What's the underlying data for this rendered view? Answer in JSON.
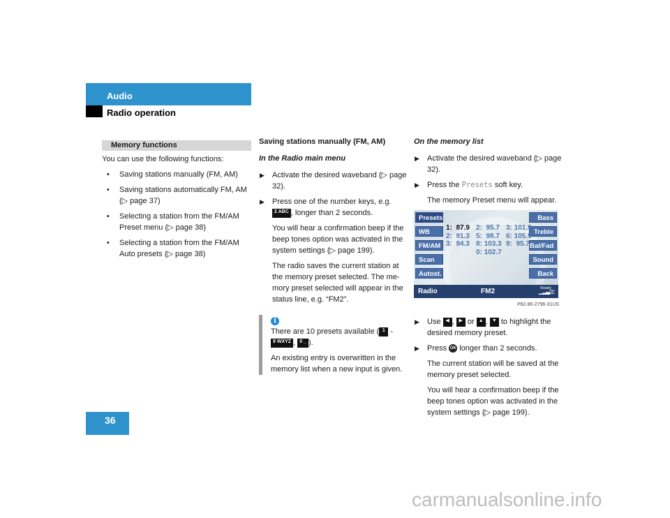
{
  "header": {
    "section": "Audio",
    "subsection": "Radio operation"
  },
  "page_number": "36",
  "left_column": {
    "section_title": "Memory functions",
    "intro": "You can use the following functions:",
    "bullet_glyph": "•",
    "bullets": [
      "Saving stations manually (FM, AM)",
      "Saving stations automatically FM, AM (▷ page 37)",
      "Selecting a station from the FM/AM Preset menu (▷ page 38)",
      "Selecting a station from the FM/AM Auto presets (▷ page 38)"
    ]
  },
  "middle_column": {
    "heading": "Saving stations manually (FM, AM)",
    "subheading": "In the Radio main menu",
    "step_glyph": "▶",
    "step1": "Activate the desired waveband (▷ page 32).",
    "step2_before": "Press one of the number keys, e.g.",
    "step2_key": "2 ABC",
    "step2_after": ", longer than 2 seconds.",
    "para1": "You will hear a confirmation beep if the beep tones option was activated in the system settings (▷ page 199).",
    "para2": "The radio saves the current station at the memory preset selected. The me-mory preset selected will appear in the status line, e.g. “FM2”.",
    "note": {
      "icon": "i",
      "line1_before": "There are 10 presets available (",
      "key_1": "1",
      "dash": " -",
      "key_9": "9 WXYZ",
      "comma": ",",
      "key_0": "0 _",
      "line1_after": ").",
      "line2": "An existing entry is overwritten in the memory list when a new input is given."
    }
  },
  "right_column": {
    "subheading": "On the memory list",
    "step1": "Activate the desired waveband (▷ page 32).",
    "step2_before": "Press the",
    "step2_softkey": "Presets",
    "step2_after": "soft key.",
    "step2_result": "The memory Preset menu will appear.",
    "screen": {
      "left_softkeys": [
        "Presets",
        "WB",
        "FM/AM",
        "Scan",
        "Autost."
      ],
      "right_softkeys": [
        "Bass",
        "Treble",
        "Bal/Fad",
        "Sound",
        "Back"
      ],
      "preset_rows": [
        [
          "1:  87.9",
          "2:  95.7",
          "3: 101.9"
        ],
        [
          "2:  91.3",
          "5:  98.7",
          "6: 105.5"
        ],
        [
          "3:  94.3",
          "8: 103.3",
          "9:  95.7"
        ],
        [
          "",
          "0: 102.7",
          ""
        ]
      ],
      "selected_preset": "1:  87.9",
      "status_left": "Radio",
      "status_band": "FM2",
      "status_ready": "Ready",
      "signal_glyph": "▁▂▃▯▯"
    },
    "figure_id": "P82.86-2796-31US",
    "step3_before": "Use",
    "key_left": "◀",
    "key_right": "▶",
    "key_up": "▲",
    "key_down": "▼",
    "step3_or": "or",
    "step3_after": "to highlight the desired memory preset.",
    "step4_before": "Press",
    "ok_key": "OK",
    "step4_after": "longer than 2 seconds.",
    "para1": "The current station will be saved at the memory preset selected.",
    "para2": "You will hear a confirmation beep if the beep tones option was activated in the system settings (▷ page 199)."
  },
  "watermark": "carmanualsonline.info",
  "colors": {
    "accent_blue": "#2e93cc",
    "softkey_blue": "#4a6fa8",
    "status_bar": "#26406d",
    "info_blue": "#1e8ad6",
    "note_bar_gray": "#9c9c9c",
    "section_bar_gray": "#d6d6d6"
  }
}
